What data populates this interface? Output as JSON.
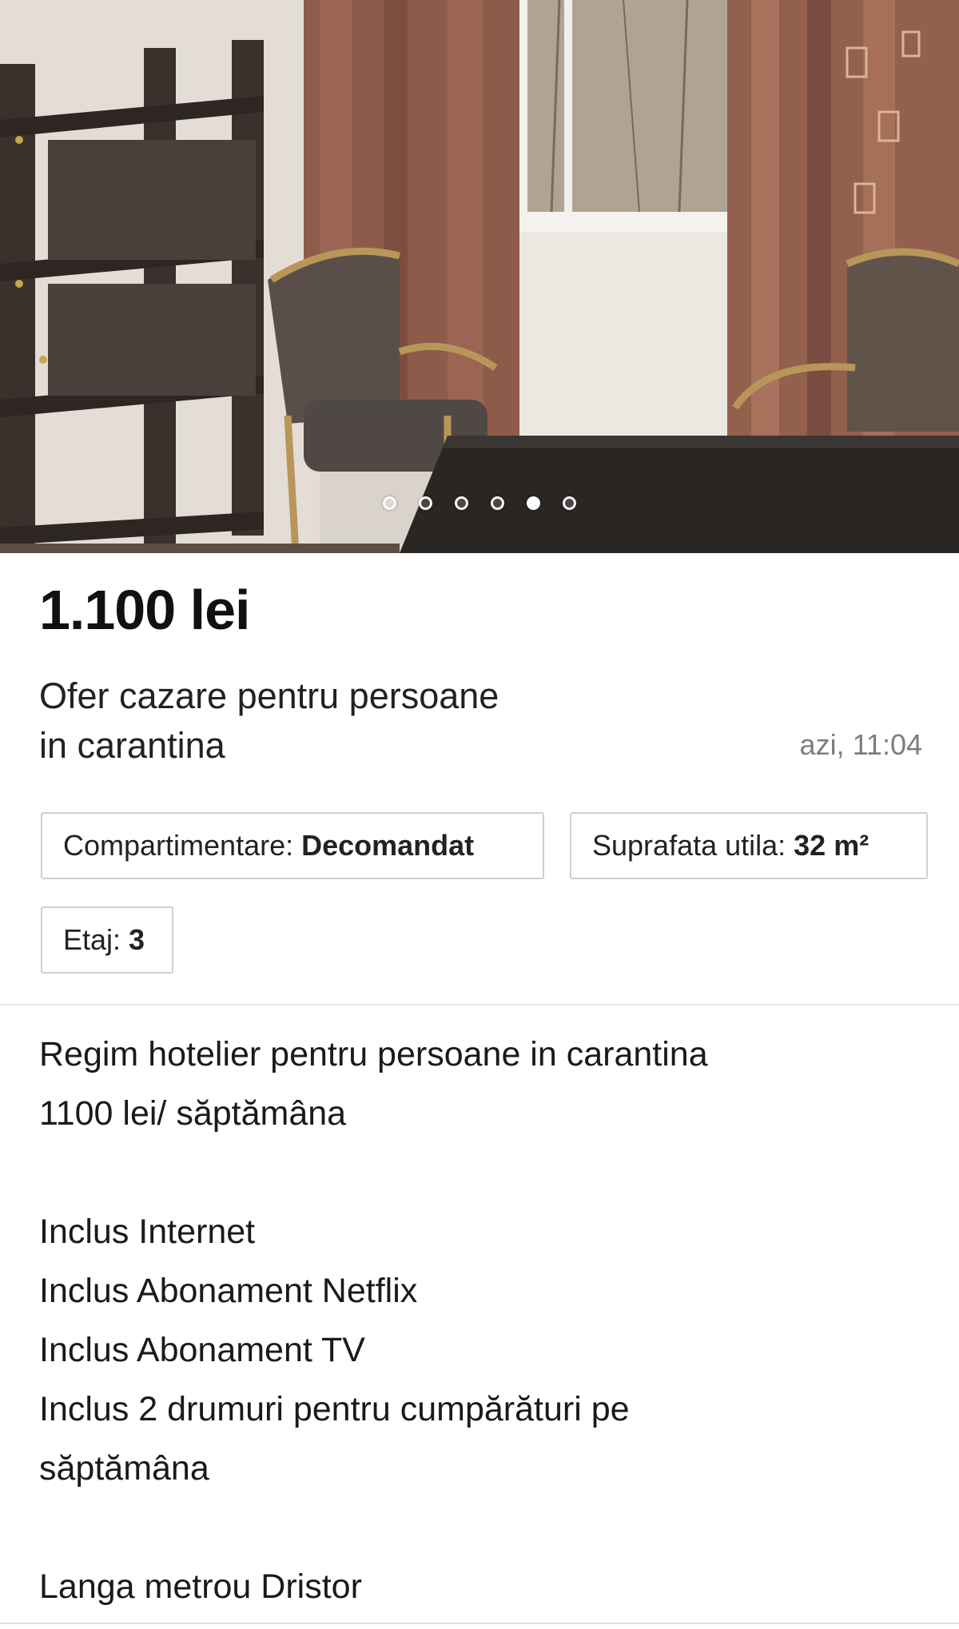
{
  "listing": {
    "photo_alt": "Apartment room with shelving, chairs and curtains",
    "carousel": {
      "count": 6,
      "active_index": 4
    },
    "price": "1.100 lei",
    "title_line_1": "Ofer cazare pentru persoane",
    "title_line_2": "in carantina",
    "posted": "azi, 11:04"
  },
  "attributes": [
    {
      "label": "Compartimentare:",
      "value": "Decomandat"
    },
    {
      "label": "Suprafata utila:",
      "value": "32 m²"
    },
    {
      "label": "Etaj:",
      "value": "3"
    }
  ],
  "description": {
    "lines": [
      "Regim hotelier pentru persoane in carantina",
      "1100 lei/ săptămâna",
      "",
      "Inclus Internet",
      "Inclus Abonament Netflix",
      "Inclus Abonament TV",
      "Inclus 2 drumuri pentru cumpărături pe",
      "săptămâna",
      "",
      "Langa metrou Dristor"
    ]
  },
  "colors": {
    "price_text": "#111111",
    "date_text": "#7d7d7d",
    "chip_border": "#cfcfcf"
  }
}
